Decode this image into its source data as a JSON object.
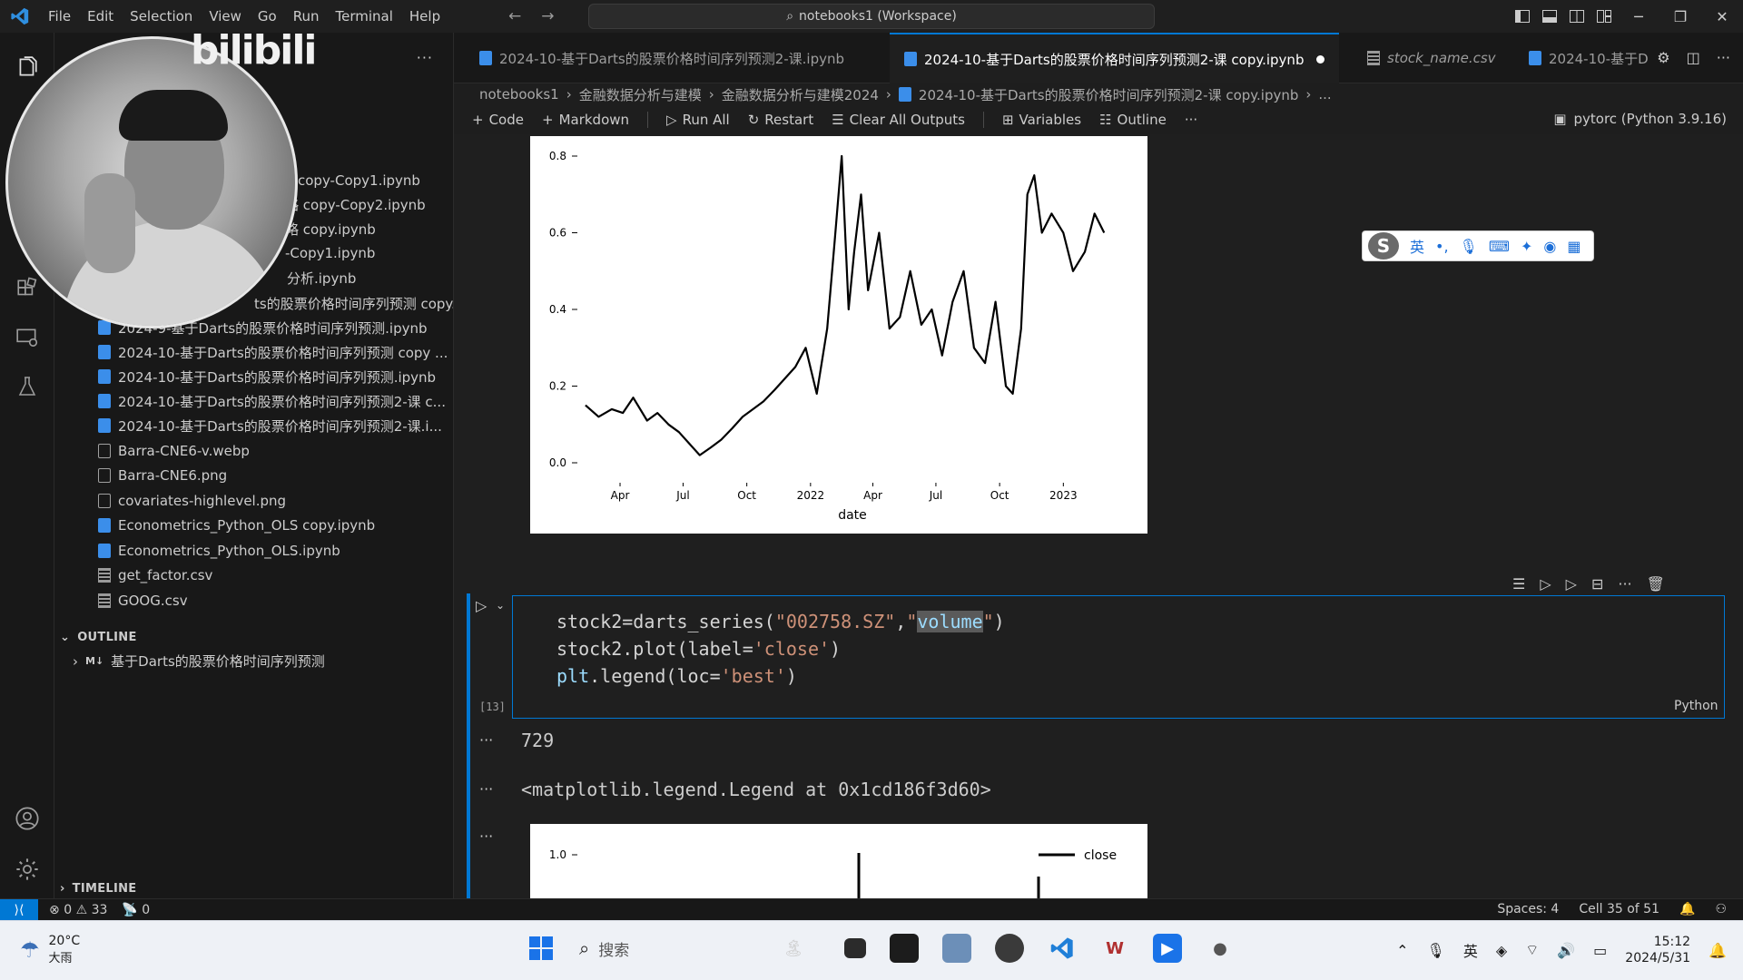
{
  "menu": [
    "File",
    "Edit",
    "Selection",
    "View",
    "Go",
    "Run",
    "Terminal",
    "Help"
  ],
  "command_center": "notebooks1 (Workspace)",
  "tabs": [
    {
      "label": "2024-10-基于Darts的股票价格时间序列预测2-课.ipynb"
    },
    {
      "label": "2024-10-基于Darts的股票价格时间序列预测2-课 copy.ipynb"
    },
    {
      "label": "stock_name.csv"
    },
    {
      "label": "2024-10-基于D"
    }
  ],
  "breadcrumb": [
    "notebooks1",
    "金融数据分析与建模",
    "金融数据分析与建模2024",
    "2024-10-基于Darts的股票价格时间序列预测2-课 copy.ipynb",
    "..."
  ],
  "toolbar": {
    "code": "Code",
    "markdown": "Markdown",
    "run_all": "Run All",
    "restart": "Restart",
    "clear": "Clear All Outputs",
    "variables": "Variables",
    "outline": "Outline"
  },
  "kernel": "pytorc (Python 3.9.16)",
  "partial_files": [
    "copy-Copy1.ipynb",
    "略 copy-Copy2.ipynb",
    "略 copy.ipynb",
    "-Copy1.ipynb",
    "分析.ipynb"
  ],
  "files": [
    {
      "name": "ts的股票价格时间序列预测 copy.ip...",
      "kind": "nb"
    },
    {
      "name": "2024-9-基于Darts的股票价格时间序列预测.ipynb",
      "kind": "nb"
    },
    {
      "name": "2024-10-基于Darts的股票价格时间序列预测 copy ...",
      "kind": "nb"
    },
    {
      "name": "2024-10-基于Darts的股票价格时间序列预测.ipynb",
      "kind": "nb"
    },
    {
      "name": "2024-10-基于Darts的股票价格时间序列预测2-课 c...",
      "kind": "nb"
    },
    {
      "name": "2024-10-基于Darts的股票价格时间序列预测2-课.i...",
      "kind": "nb"
    },
    {
      "name": "Barra-CNE6-v.webp",
      "kind": "img"
    },
    {
      "name": "Barra-CNE6.png",
      "kind": "img"
    },
    {
      "name": "covariates-highlevel.png",
      "kind": "img"
    },
    {
      "name": "Econometrics_Python_OLS copy.ipynb",
      "kind": "nb"
    },
    {
      "name": "Econometrics_Python_OLS.ipynb",
      "kind": "nb"
    },
    {
      "name": "get_factor.csv",
      "kind": "csv"
    },
    {
      "name": "GOOG.csv",
      "kind": "csv"
    }
  ],
  "outline": {
    "header": "OUTLINE",
    "item_badge": "M↓",
    "item": "基于Darts的股票价格时间序列预测"
  },
  "timeline": "TIMELINE",
  "cam_logo": "bilibili",
  "cell": {
    "exec_count": "[13]",
    "lang": "Python",
    "code_line1_a": "stock2=darts_series(",
    "code_line1_b": "\"002758.SZ\"",
    "code_line1_c": ",",
    "code_line1_d": "\"",
    "code_line1_hl": "volume",
    "code_line1_e": "\"",
    "code_line1_f": ")",
    "code_line2_a": "stock2.plot(label=",
    "code_line2_b": "'close'",
    "code_line2_c": ")",
    "code_line3_a": "plt",
    "code_line3_b": ".legend(loc=",
    "code_line3_c": "'best'",
    "code_line3_d": ")",
    "output1": "729",
    "output2": "<matplotlib.legend.Legend at 0x1cd186f3d60>"
  },
  "ime": {
    "lang": "英",
    "punct": "•,"
  },
  "chart_data": [
    {
      "type": "line",
      "title": "",
      "xlabel": "date",
      "ylabel": "",
      "ylim": [
        0.0,
        0.8
      ],
      "yticks": [
        "0.0",
        "0.2",
        "0.4",
        "0.6",
        "0.8"
      ],
      "xticks": [
        "Apr",
        "Jul",
        "Oct",
        "2022",
        "Apr",
        "Jul",
        "Oct",
        "2023"
      ],
      "x_range": [
        "2021-02",
        "2023-04"
      ],
      "grid": false,
      "legend": "none",
      "series": [
        {
          "color": "#000000",
          "x": [
            "2021-02-10",
            "2021-03-01",
            "2021-03-20",
            "2021-04-05",
            "2021-04-20",
            "2021-05-10",
            "2021-05-25",
            "2021-06-10",
            "2021-06-25",
            "2021-07-10",
            "2021-07-25",
            "2021-08-10",
            "2021-08-25",
            "2021-09-10",
            "2021-09-25",
            "2021-10-10",
            "2021-10-25",
            "2021-11-10",
            "2021-11-25",
            "2021-12-10",
            "2021-12-25",
            "2022-01-10",
            "2022-01-25",
            "2022-02-05",
            "2022-02-15",
            "2022-02-25",
            "2022-03-05",
            "2022-03-15",
            "2022-03-25",
            "2022-04-10",
            "2022-04-25",
            "2022-05-10",
            "2022-05-25",
            "2022-06-10",
            "2022-06-25",
            "2022-07-10",
            "2022-07-25",
            "2022-08-10",
            "2022-08-25",
            "2022-09-10",
            "2022-09-25",
            "2022-10-10",
            "2022-10-20",
            "2022-11-01",
            "2022-11-10",
            "2022-11-20",
            "2022-12-01",
            "2022-12-15",
            "2023-01-01",
            "2023-01-15",
            "2023-02-01",
            "2023-02-15",
            "2023-03-01"
          ],
          "values": [
            0.15,
            0.12,
            0.14,
            0.13,
            0.17,
            0.11,
            0.13,
            0.1,
            0.08,
            0.05,
            0.02,
            0.04,
            0.06,
            0.09,
            0.12,
            0.14,
            0.16,
            0.19,
            0.22,
            0.25,
            0.3,
            0.18,
            0.35,
            0.58,
            0.8,
            0.4,
            0.55,
            0.7,
            0.45,
            0.6,
            0.35,
            0.38,
            0.5,
            0.36,
            0.4,
            0.28,
            0.42,
            0.5,
            0.3,
            0.26,
            0.42,
            0.2,
            0.18,
            0.35,
            0.7,
            0.75,
            0.6,
            0.65,
            0.6,
            0.5,
            0.55,
            0.65,
            0.6
          ]
        }
      ]
    },
    {
      "type": "line",
      "title": "",
      "ylim_top": 1.0,
      "yticks": [
        "1.0"
      ],
      "legend": "top-right",
      "series": [
        {
          "name": "close",
          "color": "#000000"
        }
      ]
    }
  ],
  "status": {
    "errors": "0",
    "warnings": "33",
    "ports": "0",
    "spaces": "Spaces: 4",
    "cell": "Cell 35 of 51"
  },
  "taskbar": {
    "temp": "20°C",
    "weather": "大雨",
    "search": "搜索",
    "time": "15:12",
    "date": "2024/5/31"
  }
}
